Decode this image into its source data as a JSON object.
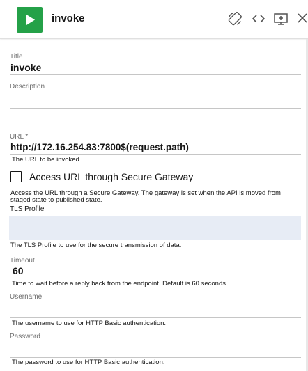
{
  "header": {
    "title": "invoke",
    "icons": [
      "play-icon",
      "rotate-device-icon",
      "code-icon",
      "add-screen-icon",
      "close-icon"
    ]
  },
  "form": {
    "title": {
      "label": "Title",
      "value": "invoke"
    },
    "description": {
      "label": "Description",
      "value": ""
    },
    "url": {
      "label": "URL *",
      "value": "http://172.16.254.83:7800$(request.path)",
      "help": "The URL to be invoked."
    },
    "secure_gateway": {
      "label": "Access URL through Secure Gateway",
      "checked": false,
      "help": "Access the URL through a Secure Gateway. The gateway is set when the API is moved from staged state to published state."
    },
    "tls_profile": {
      "label": "TLS Profile",
      "value": "",
      "help": "The TLS Profile to use for the secure transmission of data."
    },
    "timeout": {
      "label": "Timeout",
      "value": "60",
      "help": "Time to wait before a reply back from the endpoint. Default is 60 seconds."
    },
    "username": {
      "label": "Username",
      "value": "",
      "help": "The username to use for HTTP Basic authentication."
    },
    "password": {
      "label": "Password",
      "value": "",
      "help": "The password to use for HTTP Basic authentication."
    }
  },
  "colors": {
    "accent_green": "#24a148",
    "tls_field_bg": "#e7ecf5",
    "label_gray": "#6f6f6f",
    "text": "#161616"
  }
}
